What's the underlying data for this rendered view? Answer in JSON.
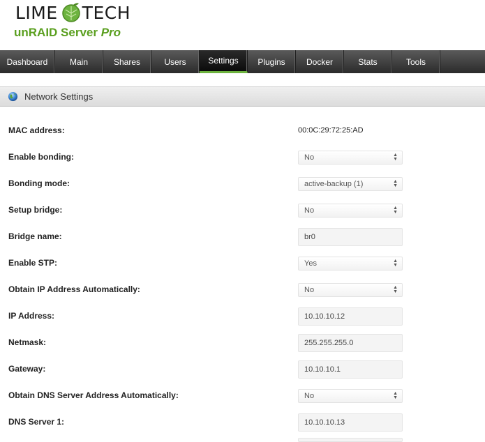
{
  "logo": {
    "left_word": "LIME",
    "right_word": "TECH"
  },
  "product": {
    "name": "unRAID Server",
    "edition": "Pro"
  },
  "colors": {
    "accent": "#6db33f",
    "product_green": "#5a9f1f",
    "nav_bg": "#3a3a3a"
  },
  "nav": {
    "tabs": [
      {
        "label": "Dashboard"
      },
      {
        "label": "Main"
      },
      {
        "label": "Shares"
      },
      {
        "label": "Users"
      },
      {
        "label": "Settings",
        "active": true
      },
      {
        "label": "Plugins"
      },
      {
        "label": "Docker"
      },
      {
        "label": "Stats"
      },
      {
        "label": "Tools"
      }
    ]
  },
  "section": {
    "title": "Network Settings",
    "icon": "globe-icon"
  },
  "form": {
    "mac_address": {
      "label": "MAC address:",
      "value": "00:0C:29:72:25:AD"
    },
    "enable_bonding": {
      "label": "Enable bonding:",
      "value": "No"
    },
    "bonding_mode": {
      "label": "Bonding mode:",
      "value": "active-backup (1)"
    },
    "setup_bridge": {
      "label": "Setup bridge:",
      "value": "No"
    },
    "bridge_name": {
      "label": "Bridge name:",
      "value": "br0"
    },
    "enable_stp": {
      "label": "Enable STP:",
      "value": "Yes"
    },
    "obtain_ip_auto": {
      "label": "Obtain IP Address Automatically:",
      "value": "No"
    },
    "ip_address": {
      "label": "IP Address:",
      "value": "10.10.10.12"
    },
    "netmask": {
      "label": "Netmask:",
      "value": "255.255.255.0"
    },
    "gateway": {
      "label": "Gateway:",
      "value": "10.10.10.1"
    },
    "obtain_dns_auto": {
      "label": "Obtain DNS Server Address Automatically:",
      "value": "No"
    },
    "dns_server_1": {
      "label": "DNS Server 1:",
      "value": "10.10.10.13"
    },
    "dns_server_2": {
      "value": ""
    }
  }
}
